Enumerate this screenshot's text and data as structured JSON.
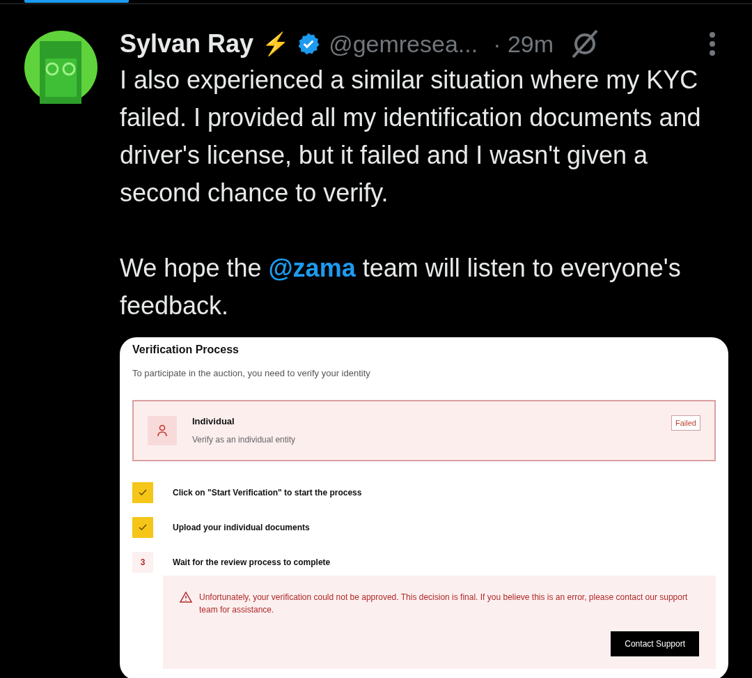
{
  "post": {
    "author": "Sylvan Ray",
    "emoji": "⚡",
    "handle": "@gemresea...",
    "time": "· 29m",
    "paragraphs": [
      [
        {
          "kind": "text",
          "text": "I also experienced a similar situation where my KYC failed. I provided all my identification documents and driver's license, but it failed and I wasn't given a second chance to verify."
        }
      ],
      [
        {
          "kind": "text",
          "text": "We hope the "
        },
        {
          "kind": "mention",
          "text": "@zama"
        },
        {
          "kind": "text",
          "text": " team will listen to everyone's feedback."
        }
      ]
    ]
  },
  "card": {
    "title": "Verification Process",
    "subtitle": "To participate in the auction, you need to verify your identity",
    "option": {
      "title": "Individual",
      "description": "Verify as an individual entity",
      "status": "Failed"
    },
    "steps": [
      {
        "kind": "done",
        "text": "Click on \"Start Verification\" to start the process"
      },
      {
        "kind": "done",
        "text": "Upload your individual documents"
      },
      {
        "kind": "number",
        "number": "3",
        "text": "Wait for the review process to complete"
      }
    ],
    "alert": {
      "message": "Unfortunately, your verification could not be approved. This decision is final. If you believe this is an error, please contact our support team for assistance.",
      "button": "Contact Support"
    }
  }
}
